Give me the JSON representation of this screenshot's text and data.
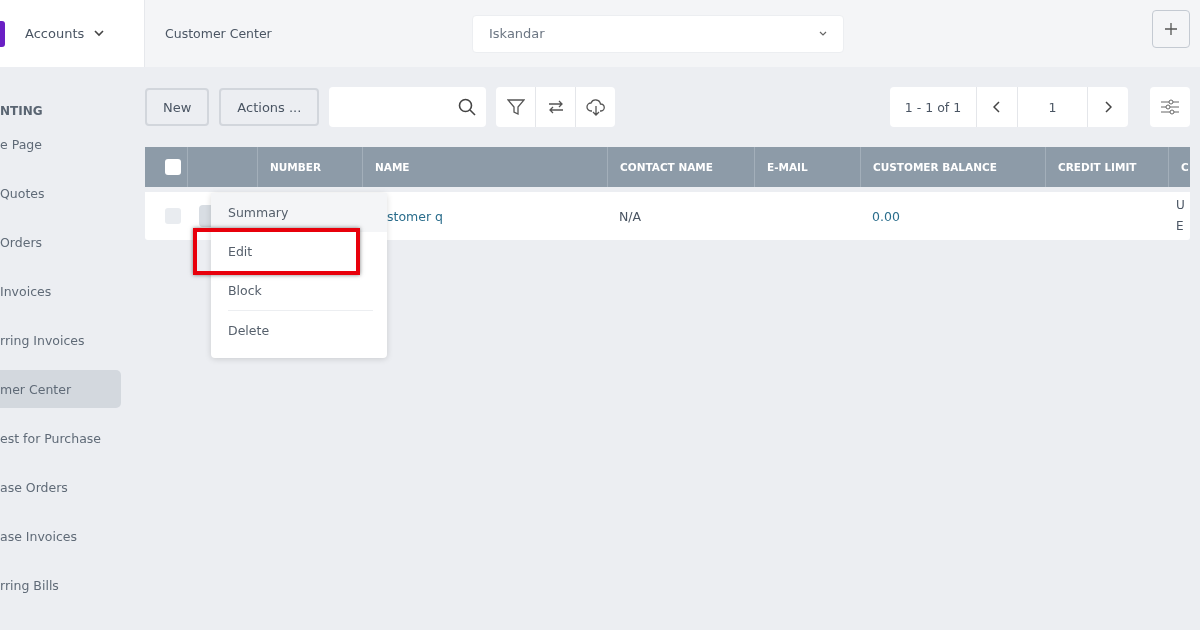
{
  "topbar": {
    "module": "Accounts",
    "breadcrumb": "Customer Center",
    "company": "Iskandar"
  },
  "sidebar": {
    "heading": "NTING",
    "items": [
      {
        "label": "e Page",
        "selected": false
      },
      {
        "label": "Quotes",
        "selected": false
      },
      {
        "label": "Orders",
        "selected": false
      },
      {
        "label": "Invoices",
        "selected": false
      },
      {
        "label": "rring Invoices",
        "selected": false
      },
      {
        "label": "mer Center",
        "selected": true
      },
      {
        "label": "est for Purchase",
        "selected": false
      },
      {
        "label": "ase Orders",
        "selected": false
      },
      {
        "label": "ase Invoices",
        "selected": false
      },
      {
        "label": "rring Bills",
        "selected": false
      }
    ]
  },
  "toolbar": {
    "buttons": [
      "New",
      "Actions ..."
    ],
    "pagination": {
      "range": "1 - 1 of 1",
      "page": "1"
    }
  },
  "table": {
    "columns": [
      "NUMBER",
      "NAME",
      "CONTACT NAME",
      "E-MAIL",
      "CUSTOMER BALANCE",
      "CREDIT LIMIT",
      "C"
    ],
    "all_checked": false,
    "rows": [
      {
        "checked": false,
        "cells": [
          null,
          "stomer q",
          "N/A",
          "",
          "0.00",
          "",
          [
            "U",
            "E"
          ]
        ]
      }
    ]
  },
  "context_menu": {
    "items": [
      {
        "label": "Summary",
        "hovered": true,
        "highlighted": false
      },
      {
        "label": "Edit",
        "hovered": false,
        "highlighted": true
      },
      {
        "label": "Block",
        "hovered": false,
        "highlighted": false
      },
      {
        "label": "Delete",
        "hovered": false,
        "highlighted": false
      }
    ]
  }
}
